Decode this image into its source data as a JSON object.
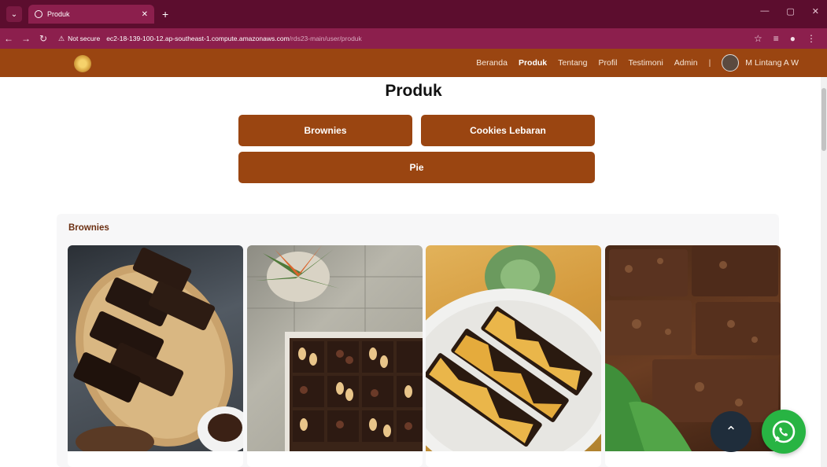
{
  "browser": {
    "tab_title": "Produk",
    "not_secure": "Not secure",
    "url_host": "ec2-18-139-100-12.ap-southeast-1.compute.amazonaws.com",
    "url_path": "/rds23-main/user/produk"
  },
  "nav": {
    "items": [
      "Beranda",
      "Produk",
      "Tentang",
      "Profil",
      "Testimoni",
      "Admin"
    ],
    "separator": "|",
    "user_name": "M Lintang A W"
  },
  "page": {
    "title": "Produk",
    "categories": [
      "Brownies",
      "Cookies Lebaran",
      "Pie"
    ],
    "section_title": "Brownies"
  },
  "colors": {
    "nav_bg": "#9a4511",
    "button_bg": "#9a4511",
    "chrome_bg": "#5c0d2e",
    "whatsapp": "#28b443",
    "scroll_top_bg": "#1f2d3b"
  },
  "icons": {
    "scroll_top": "chevron-up-icon",
    "whatsapp": "whatsapp-icon"
  }
}
